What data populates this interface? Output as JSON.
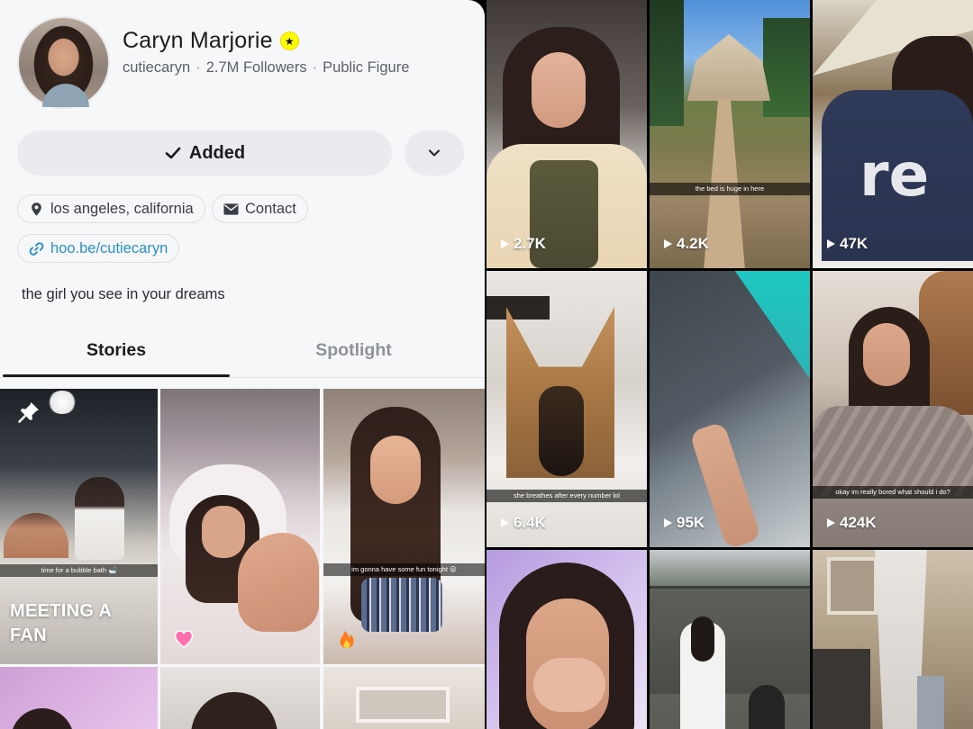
{
  "profile": {
    "display_name": "Caryn Marjorie",
    "verified_icon": "star-badge-icon",
    "username": "cutiecaryn",
    "followers": "2.7M Followers",
    "category": "Public Figure",
    "meta_separator": "·",
    "bio": "the girl you see in your dreams"
  },
  "actions": {
    "added_label": "Added",
    "more_icon": "chevron-down-icon"
  },
  "chips": {
    "location": "los angeles, california",
    "contact": "Contact",
    "link": "hoo.be/cutiecaryn"
  },
  "tabs": [
    {
      "label": "Stories",
      "active": true
    },
    {
      "label": "Spotlight",
      "active": false
    }
  ],
  "stories": [
    {
      "caption": "time for a bubble bath 🛁",
      "title_line1": "MEETING A",
      "title_line2": "FAN",
      "pinned": true
    },
    {
      "caption": "",
      "emoji": "pink-heart"
    },
    {
      "caption": "im gonna have some fun tonight 😜",
      "emoji": "fire"
    }
  ],
  "spotlight": [
    {
      "views": "2.7K",
      "caption": ""
    },
    {
      "views": "4.2K",
      "caption": "the bed is huge in here"
    },
    {
      "views": "47K",
      "caption": ""
    },
    {
      "views": "6.4K",
      "caption": "she breathes after every number lol"
    },
    {
      "views": "95K",
      "caption": ""
    },
    {
      "views": "424K",
      "caption": "okay im really bored what should i do?"
    }
  ],
  "colors": {
    "panel_bg": "#f6f7f9",
    "link": "#2a8fc9",
    "badge": "#fffc00"
  }
}
